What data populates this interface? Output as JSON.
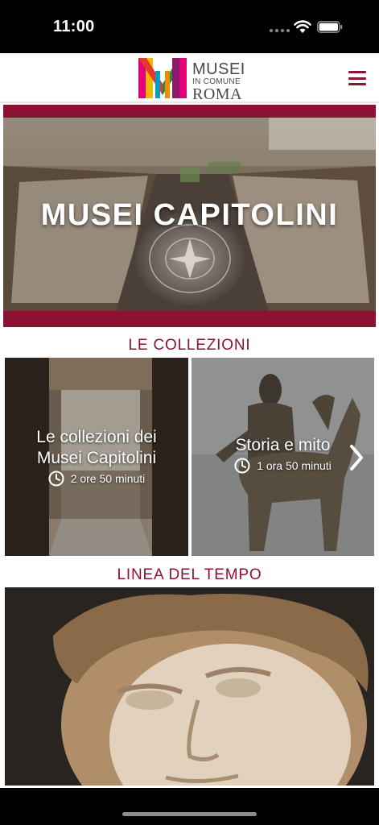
{
  "status": {
    "time": "11:00"
  },
  "header": {
    "logo_line1": "MUSEI",
    "logo_line2": "IN COMUNE",
    "logo_line3": "ROMA",
    "logo_colors": [
      "#e23b2e",
      "#f5b800",
      "#1a8e4a",
      "#8c1a6a",
      "#e3007a"
    ]
  },
  "hero": {
    "title": "MUSEI CAPITOLINI"
  },
  "collections": {
    "section_title": "LE COLLEZIONI",
    "cards": [
      {
        "title_line1": "Le collezioni dei",
        "title_line2": "Musei Capitolini",
        "duration": "2 ore 50 minuti"
      },
      {
        "title": "Storia e mito",
        "duration": "1 ora 50 minuti"
      }
    ]
  },
  "timeline": {
    "section_title": "LINEA DEL TEMPO"
  },
  "colors": {
    "accent": "#8c1233"
  }
}
